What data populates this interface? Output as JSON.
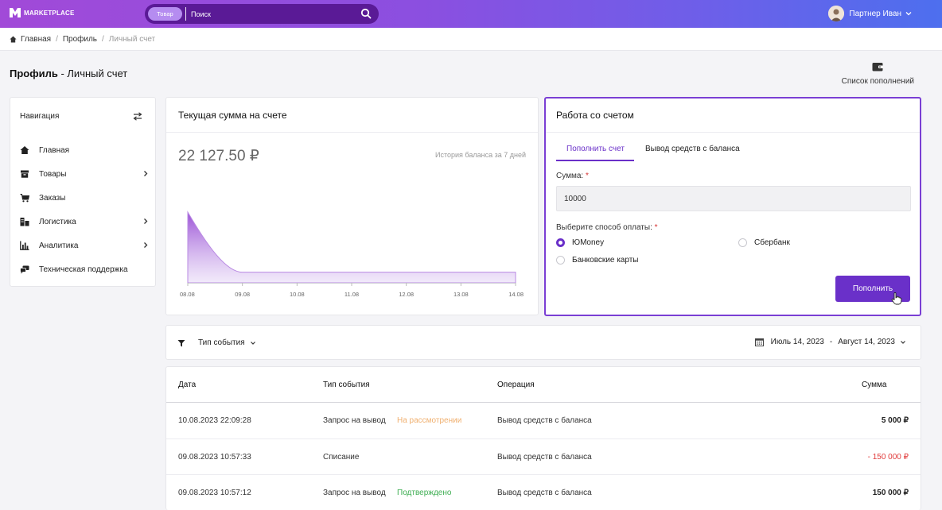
{
  "header": {
    "logo_text": "MARKETPLACE",
    "search_chip": "Товар",
    "search_placeholder": "Поиск",
    "user_name": "Партнер Иван"
  },
  "breadcrumb": {
    "items": [
      "Главная",
      "Профиль",
      "Личный счет"
    ]
  },
  "page": {
    "title_bold": "Профиль",
    "title_rest": " - Личный счет",
    "topup_list_label": "Список пополнений"
  },
  "nav": {
    "title": "Навигация",
    "items": [
      {
        "label": "Главная",
        "icon": "home-icon",
        "has_children": false
      },
      {
        "label": "Товары",
        "icon": "box-icon",
        "has_children": true
      },
      {
        "label": "Заказы",
        "icon": "cart-icon",
        "has_children": false
      },
      {
        "label": "Логистика",
        "icon": "warehouse-icon",
        "has_children": true
      },
      {
        "label": "Аналитика",
        "icon": "bar-chart-icon",
        "has_children": true
      },
      {
        "label": "Техническая поддержка",
        "icon": "chat-icon",
        "has_children": false
      }
    ]
  },
  "balance": {
    "title": "Текущая сумма на счете",
    "amount": "22 127.50 ₽",
    "history_label": "История баланса за 7 дней"
  },
  "chart_data": {
    "type": "area",
    "x": [
      "08.08",
      "09.08",
      "10.08",
      "11.08",
      "12.08",
      "13.08",
      "14.08"
    ],
    "values": [
      100,
      15,
      15,
      15,
      15,
      15,
      15
    ],
    "colors": {
      "fill": "#a361d8",
      "line": "#b98ae3"
    },
    "grid": false
  },
  "account": {
    "title": "Работа со счетом",
    "tabs": [
      "Пополнить счет",
      "Вывод средств с баланса"
    ],
    "active_tab": 0,
    "amount_label": "Сумма:",
    "amount_value": "10000",
    "method_label": "Выберите способ оплаты:",
    "methods": [
      "ЮMoney",
      "Сбербанк",
      "Банковские карты"
    ],
    "selected_method": 0,
    "submit_label": "Пополнить"
  },
  "filter": {
    "event_type_label": "Тип события",
    "date_from": "Июль 14, 2023",
    "date_to": "Август 14, 2023"
  },
  "table": {
    "headers": [
      "Дата",
      "Тип события",
      "Операция",
      "Сумма"
    ],
    "rows": [
      {
        "date": "10.08.2023 22:09:28",
        "type": "Запрос на вывод",
        "status": "На рассмотрении",
        "operation": "Вывод средств с баланса",
        "amount": "5 000 ₽"
      },
      {
        "date": "09.08.2023 10:57:33",
        "type": "Списание",
        "status": "",
        "operation": "Вывод средств с баланса",
        "amount": "- 150 000 ₽"
      },
      {
        "date": "09.08.2023 10:57:12",
        "type": "Запрос на вывод",
        "status": "Подтверждено",
        "operation": "Вывод средств с баланса",
        "amount": "150 000 ₽"
      }
    ]
  },
  "colors": {
    "accent": "#6a30c9",
    "negative": "#e03a3a",
    "status_review": "#f0b070",
    "status_ok": "#3fae53"
  }
}
